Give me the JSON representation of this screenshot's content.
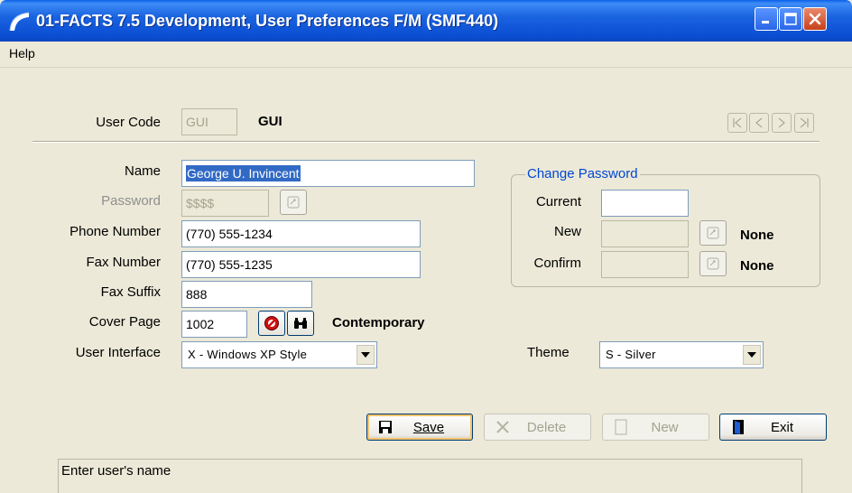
{
  "window": {
    "title": "01-FACTS 7.5 Development, User Preferences F/M (SMF440)",
    "controls": {
      "minimize": "minimize-icon",
      "maximize": "maximize-icon",
      "close": "close-icon"
    }
  },
  "menu": {
    "help": "Help"
  },
  "user_code": {
    "label": "User Code",
    "value": "GUI",
    "display": "GUI"
  },
  "nav": {
    "icons": [
      "first-record-icon",
      "previous-record-icon",
      "next-record-icon",
      "last-record-icon"
    ]
  },
  "form": {
    "name": {
      "label": "Name",
      "value": "George U. Invincent"
    },
    "password": {
      "label": "Password",
      "value": "$$$$"
    },
    "phone": {
      "label": "Phone Number",
      "value": "(770) 555-1234"
    },
    "fax": {
      "label": "Fax Number",
      "value": "(770) 555-1235"
    },
    "fax_suffix": {
      "label": "Fax Suffix",
      "value": "888"
    },
    "cover_page": {
      "label": "Cover Page",
      "value": "1002",
      "description": "Contemporary"
    },
    "user_interface": {
      "label": "User Interface",
      "selected": "X - Windows XP Style"
    },
    "theme": {
      "label": "Theme",
      "selected": "S - Silver"
    }
  },
  "change_password": {
    "title": "Change Password",
    "current_label": "Current",
    "new_label": "New",
    "new_strength": "None",
    "confirm_label": "Confirm",
    "confirm_strength": "None"
  },
  "buttons": {
    "save": "Save",
    "delete": "Delete",
    "new": "New",
    "exit": "Exit"
  },
  "status": {
    "message": "Enter user's name"
  },
  "colors": {
    "titlebar": "#0b4fd4",
    "group_title": "#0046d5",
    "background": "#ece9d8",
    "selection": "#316ac5"
  }
}
